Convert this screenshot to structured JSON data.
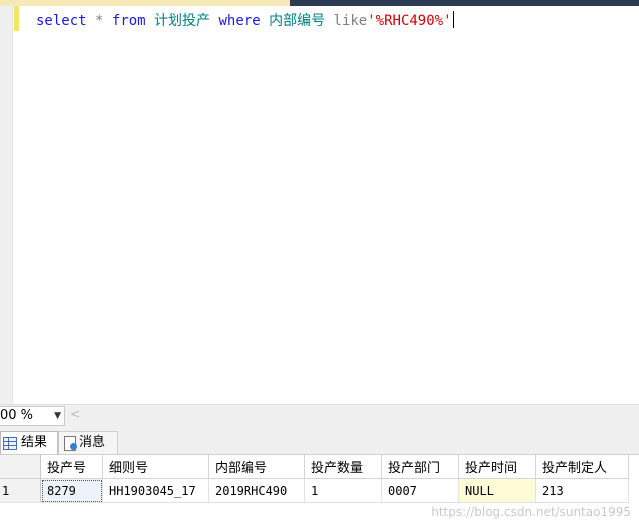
{
  "editor": {
    "sql_select": "select",
    "sql_star": "*",
    "sql_from": "from",
    "sql_table": "计划投产",
    "sql_where": "where",
    "sql_column": "内部编号",
    "sql_like": "like",
    "sql_pattern": "'%RHC490%'"
  },
  "zoom": {
    "value": "00 %"
  },
  "result_tabs": {
    "results_label": "结果",
    "messages_label": "消息"
  },
  "grid": {
    "columns": [
      "投产号",
      "细则号",
      "内部编号",
      "投产数量",
      "投产部门",
      "投产时间",
      "投产制定人"
    ],
    "rows": [
      {
        "row_number": "1",
        "cells": [
          "8279",
          "HH1903045_17",
          "2019RHC490",
          "1",
          "0007",
          "NULL",
          "213"
        ]
      }
    ]
  },
  "watermark": "https://blog.csdn.net/suntao1995"
}
